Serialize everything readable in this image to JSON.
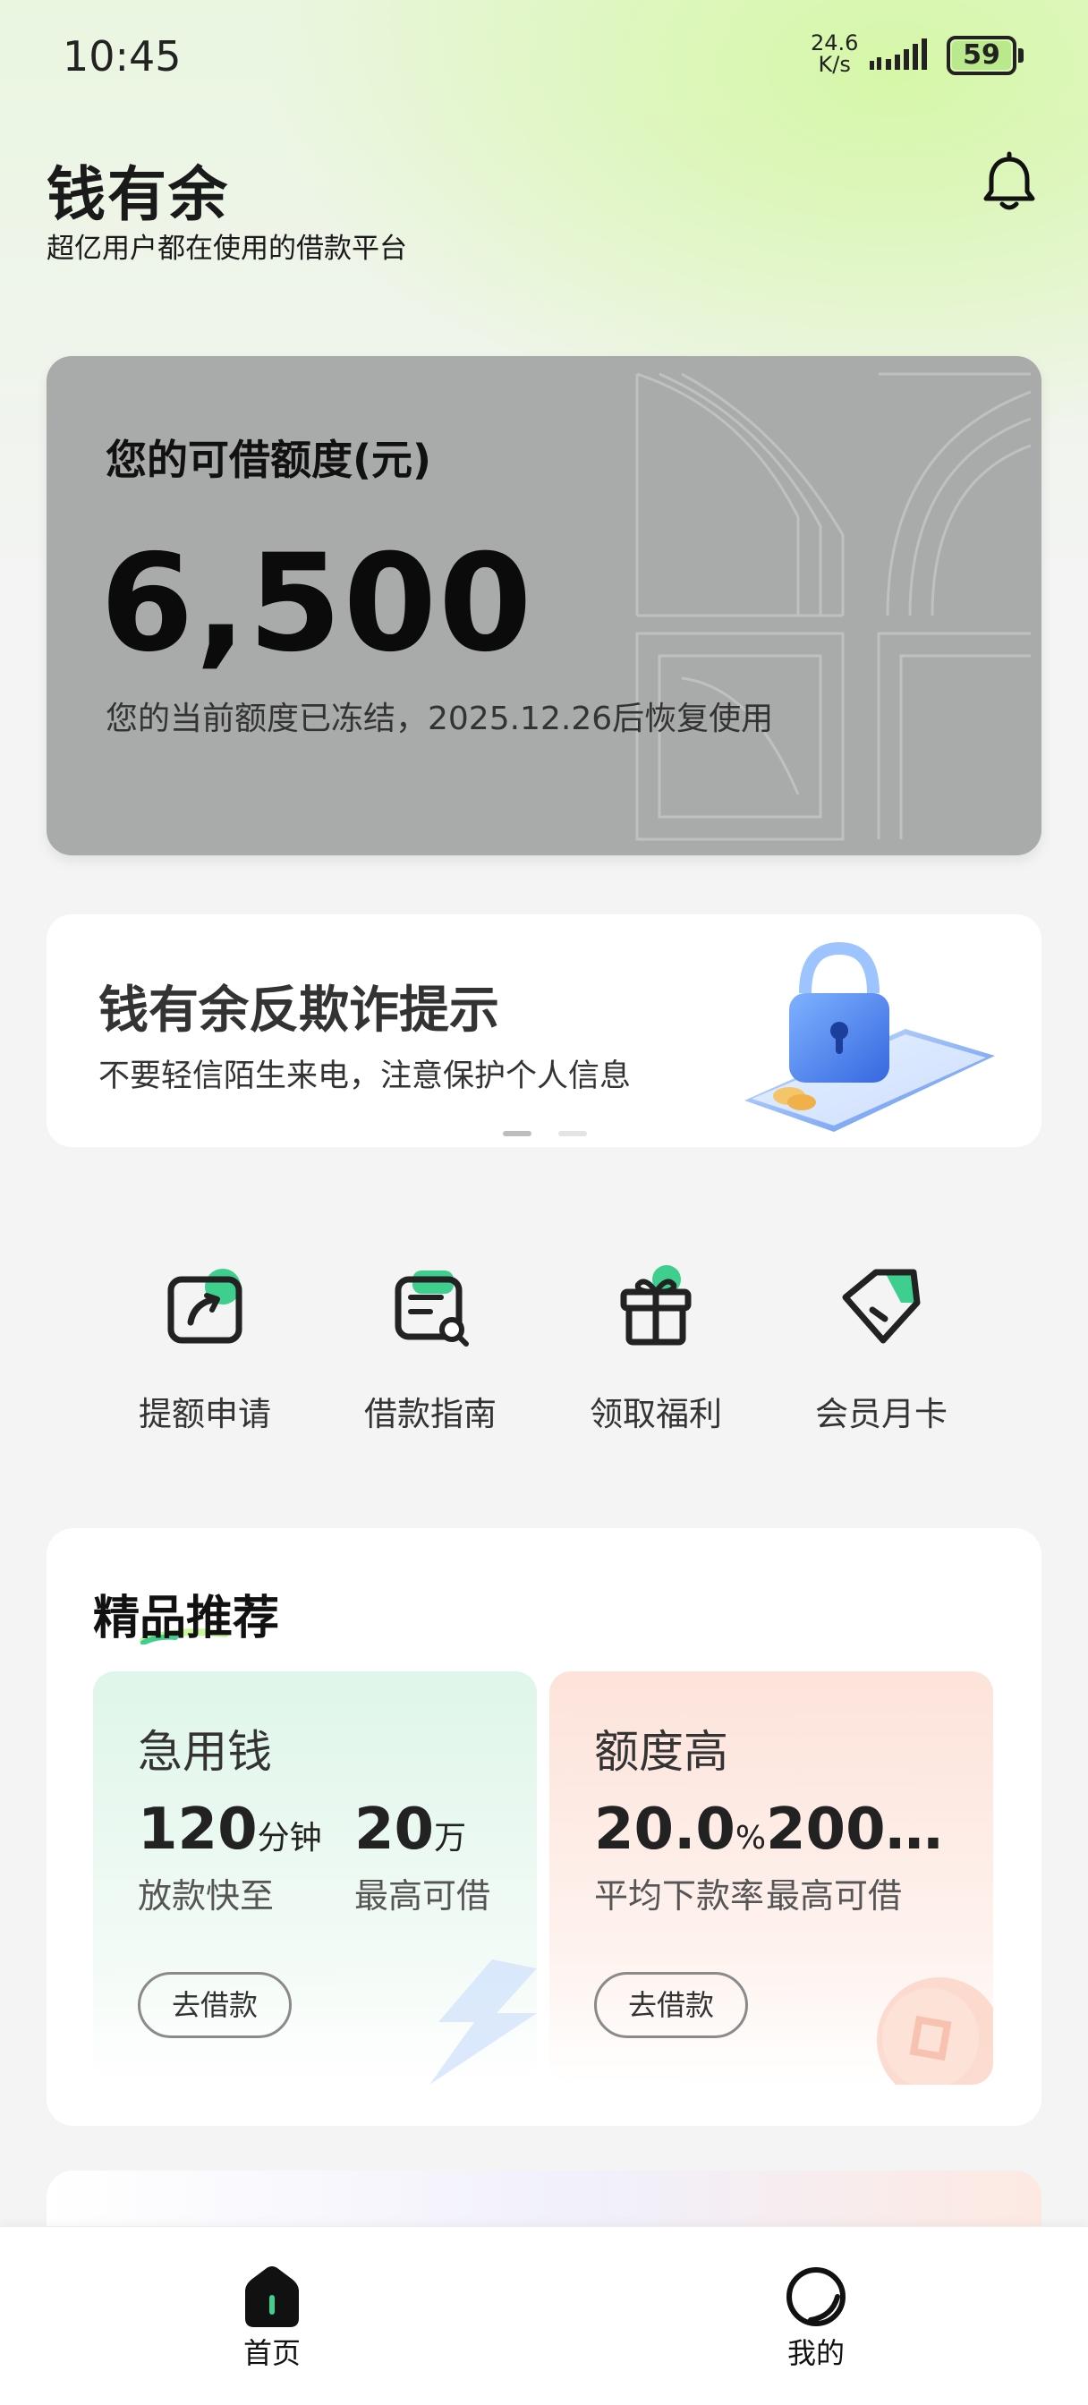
{
  "status_bar": {
    "time": "10:45",
    "net_speed_value": "24.6",
    "net_speed_unit": "K/s",
    "battery": "59"
  },
  "header": {
    "title": "钱有余",
    "subtitle": "超亿用户都在使用的借款平台",
    "bell_icon": "bell-icon"
  },
  "credit": {
    "label": "您的可借额度(元)",
    "amount": "6,500",
    "note": "您的当前额度已冻结，2025.12.26后恢复使用"
  },
  "banner": {
    "title": "钱有余反欺诈提示",
    "subtitle": "不要轻信陌生来电，注意保护个人信息",
    "illustration": "lock-phone-illustration",
    "active_slide": 1,
    "slide_count": 2
  },
  "quick_actions": [
    {
      "label": "提额申请",
      "icon": "raise-limit-icon"
    },
    {
      "label": "借款指南",
      "icon": "loan-guide-icon"
    },
    {
      "label": "领取福利",
      "icon": "gift-icon"
    },
    {
      "label": "会员月卡",
      "icon": "member-card-icon"
    }
  ],
  "featured": {
    "title": "精品推荐",
    "products": [
      {
        "name": "急用钱",
        "stat1_value": "120",
        "stat1_unit": "分钟",
        "stat1_label": "放款快至",
        "stat2_value": "20",
        "stat2_unit": "万",
        "stat2_label": "最高可借",
        "button": "去借款"
      },
      {
        "name": "额度高",
        "stat1_value": "20.0",
        "stat1_unit": "%",
        "stat1_label": "平均下款率",
        "stat2_value": "200…",
        "stat2_unit": "",
        "stat2_label": "最高可借",
        "button": "去借款"
      }
    ]
  },
  "bottom_nav": [
    {
      "label": "首页",
      "icon": "home-icon",
      "active": true
    },
    {
      "label": "我的",
      "icon": "profile-icon",
      "active": false
    }
  ],
  "colors": {
    "accent_green": "#3ecf8e",
    "card_gray": "#a9abaa",
    "highlight_yellow_green": "#c8f59a"
  }
}
